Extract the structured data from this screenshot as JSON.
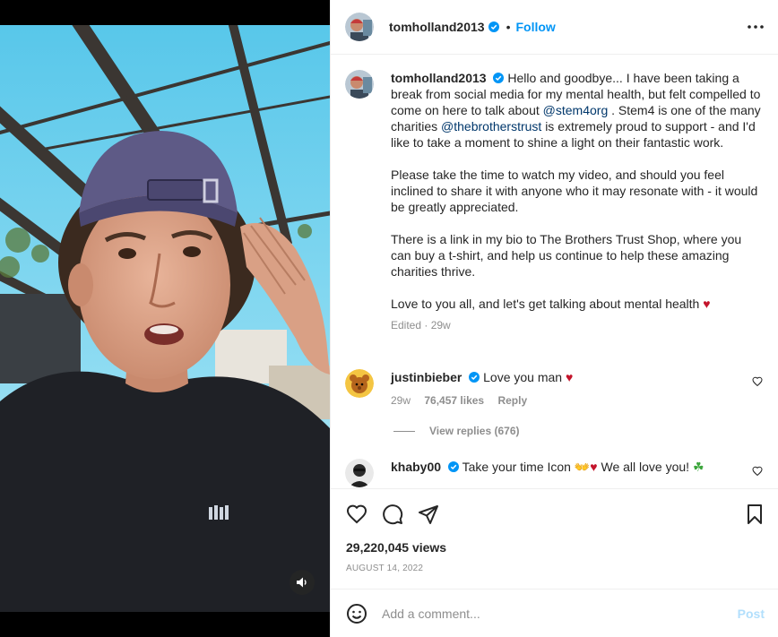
{
  "post": {
    "username": "tomholland2013",
    "follow_label": "Follow",
    "separator": "•",
    "caption": {
      "intro": "Hello and goodbye... I have been taking a break from social media for my mental health, but felt compelled to come on here to talk about",
      "mention1": "@stem4org",
      "mid": ". Stem4 is one of the many charities",
      "mention2": "@thebrotherstrust",
      "outro": "is extremely proud to support - and I'd like to take a moment to shine a light on their fantastic work.",
      "para2": "Please take the time to watch my video, and should you feel inclined to share it with anyone who it may resonate with - it would be greatly appreciated.",
      "para3": "There is a link in my bio to The Brothers Trust Shop, where you can buy a t-shirt, and help us continue to help these amazing charities thrive.",
      "para4": "Love to you all, and let's get talking about mental health",
      "heart": "♥",
      "meta": "Edited · 29w"
    },
    "comments": [
      {
        "username": "justinbieber",
        "text": "Love you man",
        "emoji": "♥",
        "age": "29w",
        "likes": "76,457 likes",
        "reply_label": "Reply",
        "view_replies": "View replies (676)"
      },
      {
        "username": "khaby00",
        "text": "Take your time Icon",
        "emoji_hands": "👐",
        "emoji_heart": "♥",
        "text2": "We all love you!",
        "emoji_clover": "☘"
      }
    ],
    "views": "29,220,045 views",
    "date": "AUGUST 14, 2022",
    "add_comment_placeholder": "Add a comment...",
    "post_label": "Post"
  },
  "colors": {
    "accent": "#0095f6",
    "mention": "#00376b",
    "muted": "#8e8e8e",
    "heart": "#c4142b",
    "post_disabled": "#b2dffc"
  },
  "icons": [
    "verified-icon",
    "more-options-icon",
    "heart-icon",
    "comment-icon",
    "share-icon",
    "save-icon",
    "emoji-icon",
    "sound-icon"
  ]
}
